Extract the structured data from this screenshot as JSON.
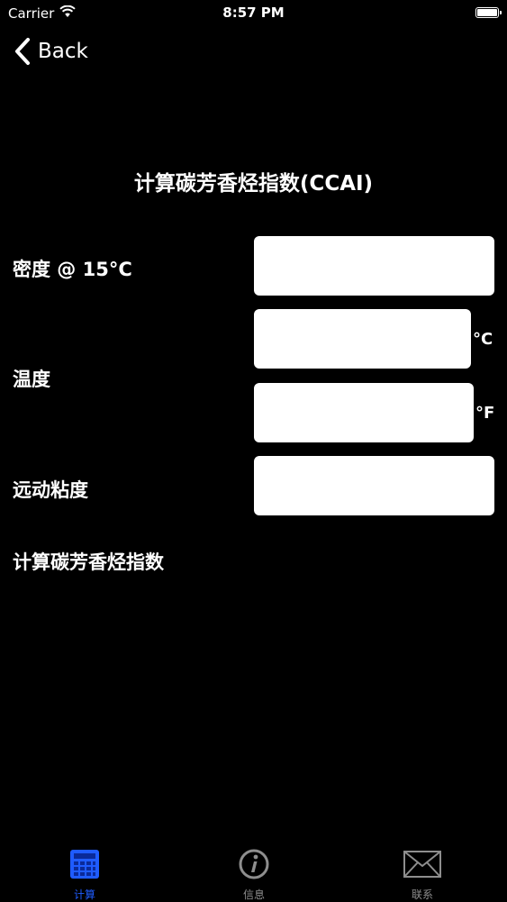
{
  "status_bar": {
    "carrier": "Carrier",
    "time": "8:57 PM"
  },
  "nav": {
    "back_label": "Back"
  },
  "page": {
    "title": "计算碳芳香烃指数(CCAI)"
  },
  "form": {
    "density_label": "密度 @ 15°C",
    "temperature_label": "温度",
    "unit_celsius": "°C",
    "unit_fahrenheit": "°F",
    "viscosity_label": "远动粘度",
    "result_label": "计算碳芳香烃指数",
    "density_value": "",
    "temp_c_value": "",
    "temp_f_value": "",
    "viscosity_value": ""
  },
  "tabs": [
    {
      "label": "计算",
      "icon": "calculator-icon",
      "active": true
    },
    {
      "label": "信息",
      "icon": "info-icon",
      "active": false
    },
    {
      "label": "联系",
      "icon": "mail-icon",
      "active": false
    }
  ],
  "colors": {
    "background": "#000000",
    "active_tab": "#1f5cff",
    "inactive_tab": "#8e8e8e",
    "input_bg": "#ffffff"
  }
}
